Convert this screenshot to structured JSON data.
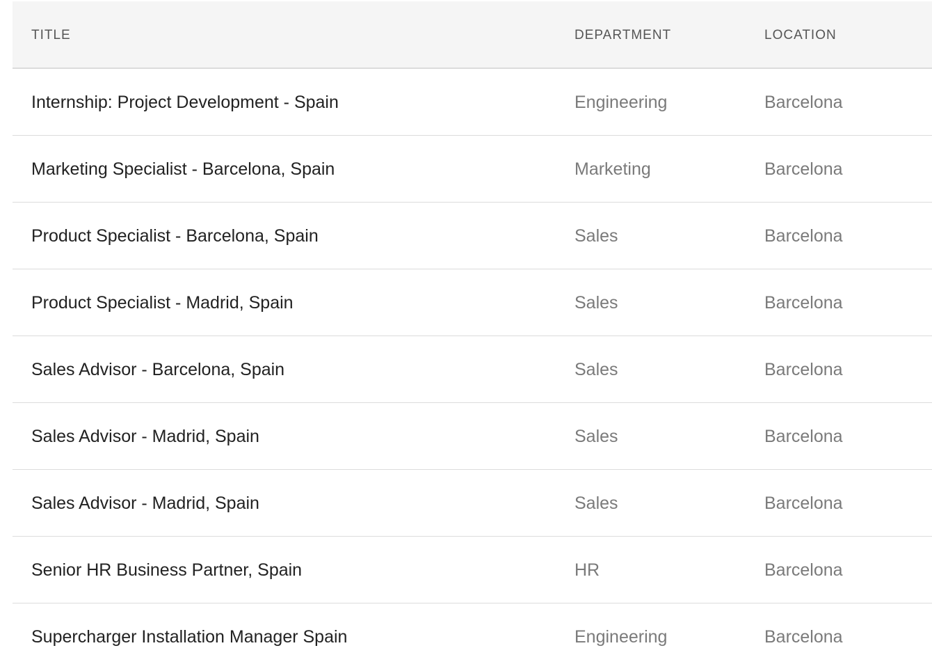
{
  "table": {
    "headers": {
      "title": "TITLE",
      "department": "DEPARTMENT",
      "location": "LOCATION"
    },
    "rows": [
      {
        "title": "Internship: Project Development - Spain",
        "department": "Engineering",
        "location": "Barcelona"
      },
      {
        "title": "Marketing Specialist - Barcelona, Spain",
        "department": "Marketing",
        "location": "Barcelona"
      },
      {
        "title": "Product Specialist - Barcelona, Spain",
        "department": "Sales",
        "location": "Barcelona"
      },
      {
        "title": "Product Specialist - Madrid, Spain",
        "department": "Sales",
        "location": "Barcelona"
      },
      {
        "title": "Sales Advisor - Barcelona, Spain",
        "department": "Sales",
        "location": "Barcelona"
      },
      {
        "title": "Sales Advisor - Madrid, Spain",
        "department": "Sales",
        "location": "Barcelona"
      },
      {
        "title": "Sales Advisor - Madrid, Spain",
        "department": "Sales",
        "location": "Barcelona"
      },
      {
        "title": "Senior HR Business Partner, Spain",
        "department": "HR",
        "location": "Barcelona"
      },
      {
        "title": "Supercharger Installation Manager Spain",
        "department": "Engineering",
        "location": "Barcelona"
      }
    ]
  },
  "colors": {
    "header_bg": "#f5f5f5",
    "title_text": "#222222",
    "muted_text": "#7a7a7a",
    "divider": "#dcdcdc"
  }
}
